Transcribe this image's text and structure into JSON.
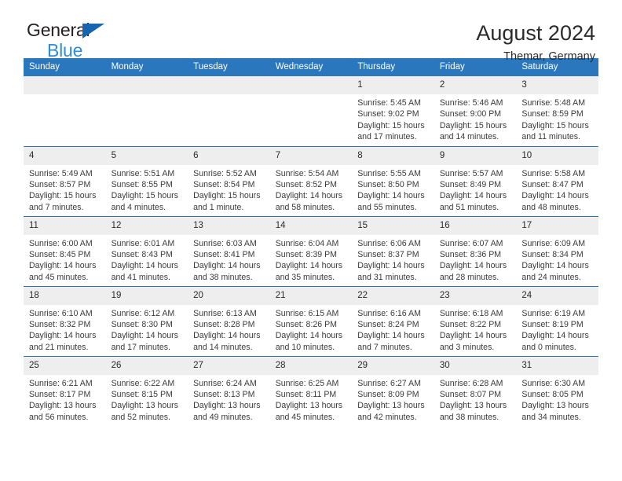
{
  "brand": {
    "name_part1": "General",
    "name_part2": "Blue",
    "triangle_color": "#1565b0",
    "blue_color": "#2e8bd8"
  },
  "header": {
    "title": "August 2024",
    "location": "Themar, Germany"
  },
  "theme": {
    "header_blue": "#2b77bd",
    "daynum_gray": "#eeeeee",
    "text": "#2b2b2b"
  },
  "columns": [
    "Sunday",
    "Monday",
    "Tuesday",
    "Wednesday",
    "Thursday",
    "Friday",
    "Saturday"
  ],
  "labels": {
    "sunrise": "Sunrise:",
    "sunset": "Sunset:",
    "daylight": "Daylight:"
  },
  "weeks": [
    [
      {
        "day": ""
      },
      {
        "day": ""
      },
      {
        "day": ""
      },
      {
        "day": ""
      },
      {
        "day": "1",
        "sunrise": "Sunrise: 5:45 AM",
        "sunset": "Sunset: 9:02 PM",
        "daylight_line1": "Daylight: 15 hours",
        "daylight_line2": "and 17 minutes."
      },
      {
        "day": "2",
        "sunrise": "Sunrise: 5:46 AM",
        "sunset": "Sunset: 9:00 PM",
        "daylight_line1": "Daylight: 15 hours",
        "daylight_line2": "and 14 minutes."
      },
      {
        "day": "3",
        "sunrise": "Sunrise: 5:48 AM",
        "sunset": "Sunset: 8:59 PM",
        "daylight_line1": "Daylight: 15 hours",
        "daylight_line2": "and 11 minutes."
      }
    ],
    [
      {
        "day": "4",
        "sunrise": "Sunrise: 5:49 AM",
        "sunset": "Sunset: 8:57 PM",
        "daylight_line1": "Daylight: 15 hours",
        "daylight_line2": "and 7 minutes."
      },
      {
        "day": "5",
        "sunrise": "Sunrise: 5:51 AM",
        "sunset": "Sunset: 8:55 PM",
        "daylight_line1": "Daylight: 15 hours",
        "daylight_line2": "and 4 minutes."
      },
      {
        "day": "6",
        "sunrise": "Sunrise: 5:52 AM",
        "sunset": "Sunset: 8:54 PM",
        "daylight_line1": "Daylight: 15 hours",
        "daylight_line2": "and 1 minute."
      },
      {
        "day": "7",
        "sunrise": "Sunrise: 5:54 AM",
        "sunset": "Sunset: 8:52 PM",
        "daylight_line1": "Daylight: 14 hours",
        "daylight_line2": "and 58 minutes."
      },
      {
        "day": "8",
        "sunrise": "Sunrise: 5:55 AM",
        "sunset": "Sunset: 8:50 PM",
        "daylight_line1": "Daylight: 14 hours",
        "daylight_line2": "and 55 minutes."
      },
      {
        "day": "9",
        "sunrise": "Sunrise: 5:57 AM",
        "sunset": "Sunset: 8:49 PM",
        "daylight_line1": "Daylight: 14 hours",
        "daylight_line2": "and 51 minutes."
      },
      {
        "day": "10",
        "sunrise": "Sunrise: 5:58 AM",
        "sunset": "Sunset: 8:47 PM",
        "daylight_line1": "Daylight: 14 hours",
        "daylight_line2": "and 48 minutes."
      }
    ],
    [
      {
        "day": "11",
        "sunrise": "Sunrise: 6:00 AM",
        "sunset": "Sunset: 8:45 PM",
        "daylight_line1": "Daylight: 14 hours",
        "daylight_line2": "and 45 minutes."
      },
      {
        "day": "12",
        "sunrise": "Sunrise: 6:01 AM",
        "sunset": "Sunset: 8:43 PM",
        "daylight_line1": "Daylight: 14 hours",
        "daylight_line2": "and 41 minutes."
      },
      {
        "day": "13",
        "sunrise": "Sunrise: 6:03 AM",
        "sunset": "Sunset: 8:41 PM",
        "daylight_line1": "Daylight: 14 hours",
        "daylight_line2": "and 38 minutes."
      },
      {
        "day": "14",
        "sunrise": "Sunrise: 6:04 AM",
        "sunset": "Sunset: 8:39 PM",
        "daylight_line1": "Daylight: 14 hours",
        "daylight_line2": "and 35 minutes."
      },
      {
        "day": "15",
        "sunrise": "Sunrise: 6:06 AM",
        "sunset": "Sunset: 8:37 PM",
        "daylight_line1": "Daylight: 14 hours",
        "daylight_line2": "and 31 minutes."
      },
      {
        "day": "16",
        "sunrise": "Sunrise: 6:07 AM",
        "sunset": "Sunset: 8:36 PM",
        "daylight_line1": "Daylight: 14 hours",
        "daylight_line2": "and 28 minutes."
      },
      {
        "day": "17",
        "sunrise": "Sunrise: 6:09 AM",
        "sunset": "Sunset: 8:34 PM",
        "daylight_line1": "Daylight: 14 hours",
        "daylight_line2": "and 24 minutes."
      }
    ],
    [
      {
        "day": "18",
        "sunrise": "Sunrise: 6:10 AM",
        "sunset": "Sunset: 8:32 PM",
        "daylight_line1": "Daylight: 14 hours",
        "daylight_line2": "and 21 minutes."
      },
      {
        "day": "19",
        "sunrise": "Sunrise: 6:12 AM",
        "sunset": "Sunset: 8:30 PM",
        "daylight_line1": "Daylight: 14 hours",
        "daylight_line2": "and 17 minutes."
      },
      {
        "day": "20",
        "sunrise": "Sunrise: 6:13 AM",
        "sunset": "Sunset: 8:28 PM",
        "daylight_line1": "Daylight: 14 hours",
        "daylight_line2": "and 14 minutes."
      },
      {
        "day": "21",
        "sunrise": "Sunrise: 6:15 AM",
        "sunset": "Sunset: 8:26 PM",
        "daylight_line1": "Daylight: 14 hours",
        "daylight_line2": "and 10 minutes."
      },
      {
        "day": "22",
        "sunrise": "Sunrise: 6:16 AM",
        "sunset": "Sunset: 8:24 PM",
        "daylight_line1": "Daylight: 14 hours",
        "daylight_line2": "and 7 minutes."
      },
      {
        "day": "23",
        "sunrise": "Sunrise: 6:18 AM",
        "sunset": "Sunset: 8:22 PM",
        "daylight_line1": "Daylight: 14 hours",
        "daylight_line2": "and 3 minutes."
      },
      {
        "day": "24",
        "sunrise": "Sunrise: 6:19 AM",
        "sunset": "Sunset: 8:19 PM",
        "daylight_line1": "Daylight: 14 hours",
        "daylight_line2": "and 0 minutes."
      }
    ],
    [
      {
        "day": "25",
        "sunrise": "Sunrise: 6:21 AM",
        "sunset": "Sunset: 8:17 PM",
        "daylight_line1": "Daylight: 13 hours",
        "daylight_line2": "and 56 minutes."
      },
      {
        "day": "26",
        "sunrise": "Sunrise: 6:22 AM",
        "sunset": "Sunset: 8:15 PM",
        "daylight_line1": "Daylight: 13 hours",
        "daylight_line2": "and 52 minutes."
      },
      {
        "day": "27",
        "sunrise": "Sunrise: 6:24 AM",
        "sunset": "Sunset: 8:13 PM",
        "daylight_line1": "Daylight: 13 hours",
        "daylight_line2": "and 49 minutes."
      },
      {
        "day": "28",
        "sunrise": "Sunrise: 6:25 AM",
        "sunset": "Sunset: 8:11 PM",
        "daylight_line1": "Daylight: 13 hours",
        "daylight_line2": "and 45 minutes."
      },
      {
        "day": "29",
        "sunrise": "Sunrise: 6:27 AM",
        "sunset": "Sunset: 8:09 PM",
        "daylight_line1": "Daylight: 13 hours",
        "daylight_line2": "and 42 minutes."
      },
      {
        "day": "30",
        "sunrise": "Sunrise: 6:28 AM",
        "sunset": "Sunset: 8:07 PM",
        "daylight_line1": "Daylight: 13 hours",
        "daylight_line2": "and 38 minutes."
      },
      {
        "day": "31",
        "sunrise": "Sunrise: 6:30 AM",
        "sunset": "Sunset: 8:05 PM",
        "daylight_line1": "Daylight: 13 hours",
        "daylight_line2": "and 34 minutes."
      }
    ]
  ]
}
